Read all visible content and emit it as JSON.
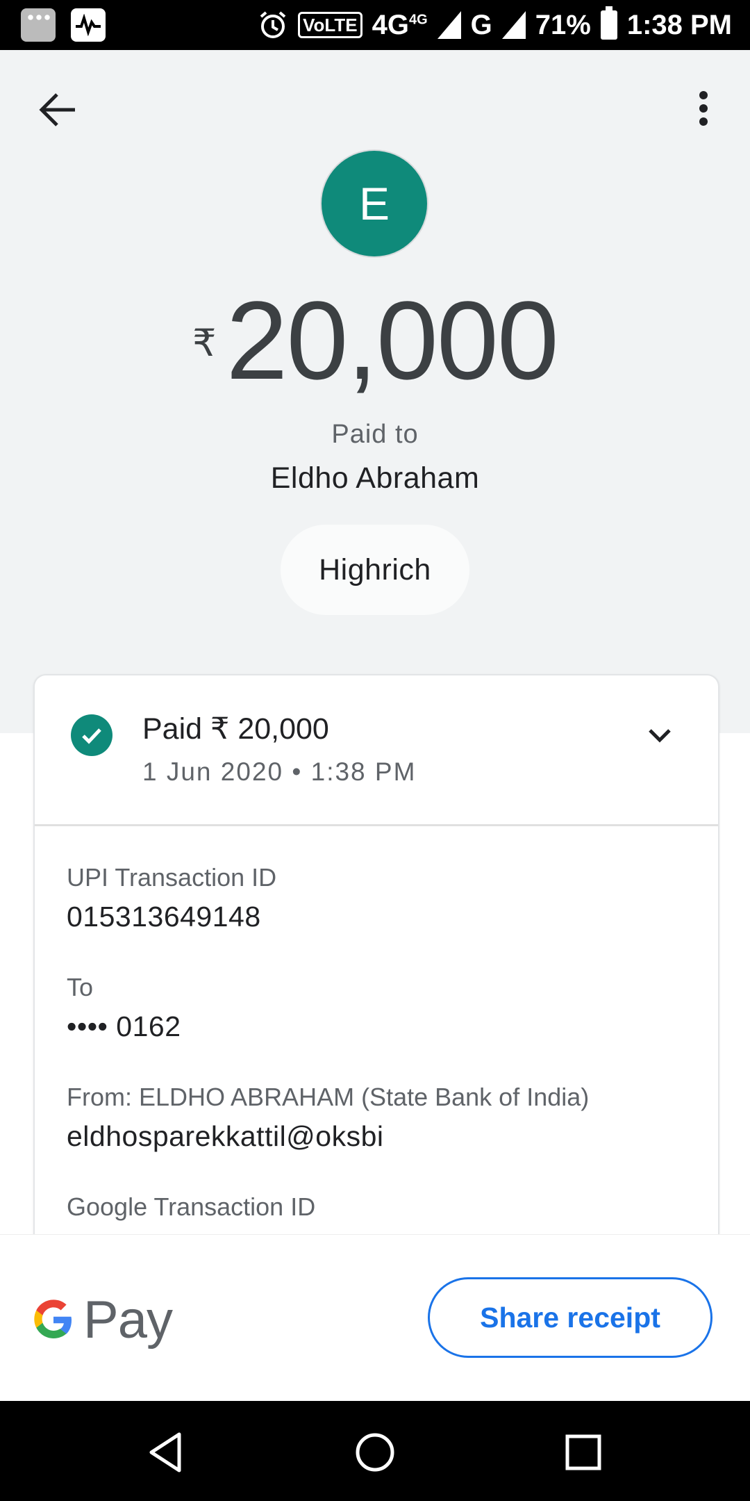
{
  "status_bar": {
    "network_label": "4G",
    "network_sup": "4G",
    "volte": "VoLTE",
    "carrier2": "G",
    "battery": "71%",
    "time": "1:38 PM"
  },
  "header": {
    "avatar_letter": "E",
    "currency_symbol": "₹",
    "amount": "20,000",
    "paid_to_label": "Paid to",
    "payee_name": "Eldho Abraham",
    "note": "Highrich"
  },
  "details": {
    "status_text": "Paid ₹ 20,000",
    "datetime": "1 Jun 2020 • 1:38 PM",
    "upi_label": "UPI Transaction ID",
    "upi_value": "015313649148",
    "to_label": "To",
    "to_value": "•••• 0162",
    "from_label": "From: ELDHO  ABRAHAM (State Bank of India)",
    "from_value": "eldhosparekkattil@oksbi",
    "google_txn_label": "Google Transaction ID"
  },
  "footer": {
    "brand_pay": "Pay",
    "share_label": "Share receipt"
  },
  "colors": {
    "accent_green": "#0f8a7a",
    "link_blue": "#1a73e8"
  }
}
